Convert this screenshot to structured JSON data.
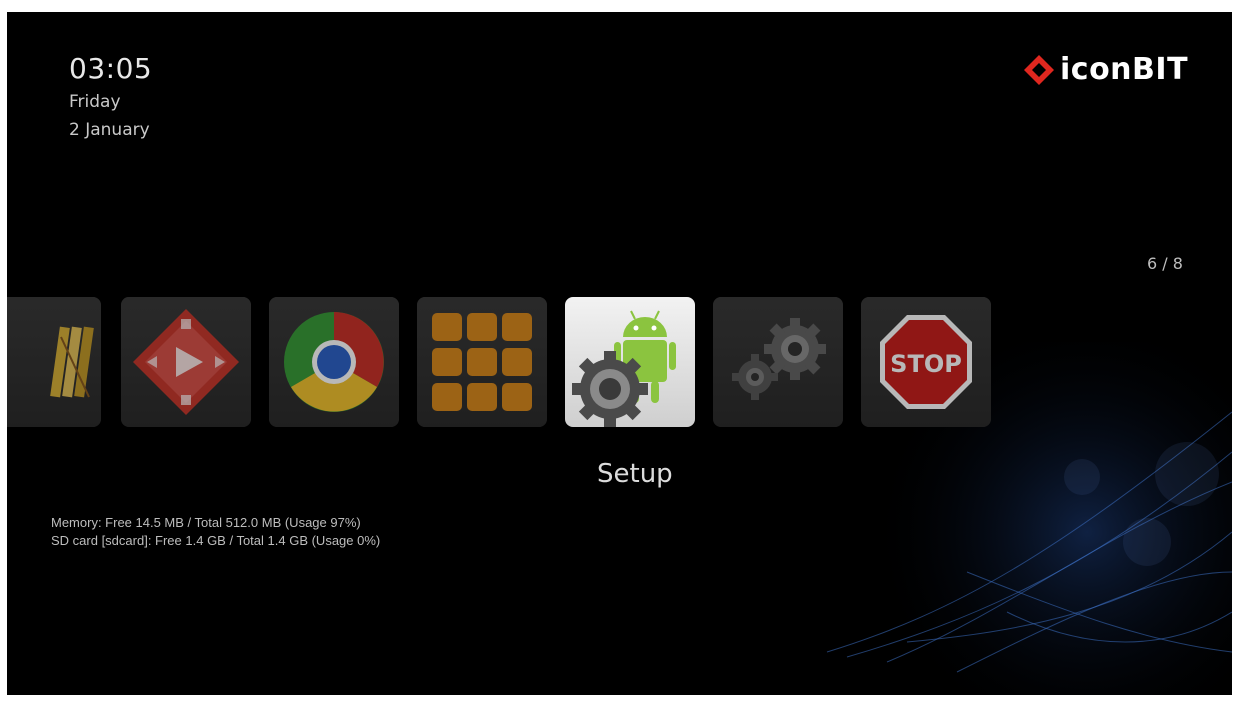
{
  "header": {
    "time": "03:05",
    "day": "Friday",
    "date": "2 January"
  },
  "brand": {
    "logo_text": "iconBIT",
    "logo_color": "#e0271f"
  },
  "pager": {
    "current": 6,
    "total": 8,
    "label": "6 / 8"
  },
  "apps": [
    {
      "icon": "books-icon"
    },
    {
      "icon": "media-player-icon"
    },
    {
      "icon": "browser-icon"
    },
    {
      "icon": "app-grid-icon"
    },
    {
      "icon": "android-setup-icon",
      "selected": true
    },
    {
      "icon": "gears-icon"
    },
    {
      "icon": "stop-sign-icon"
    }
  ],
  "selected_app": {
    "label": "Setup"
  },
  "system_info": {
    "memory": "Memory: Free 14.5 MB / Total 512.0 MB (Usage 97%)",
    "sdcard": "SD card [sdcard]: Free 1.4 GB / Total 1.4 GB (Usage 0%)"
  },
  "stop_label": "STOP"
}
